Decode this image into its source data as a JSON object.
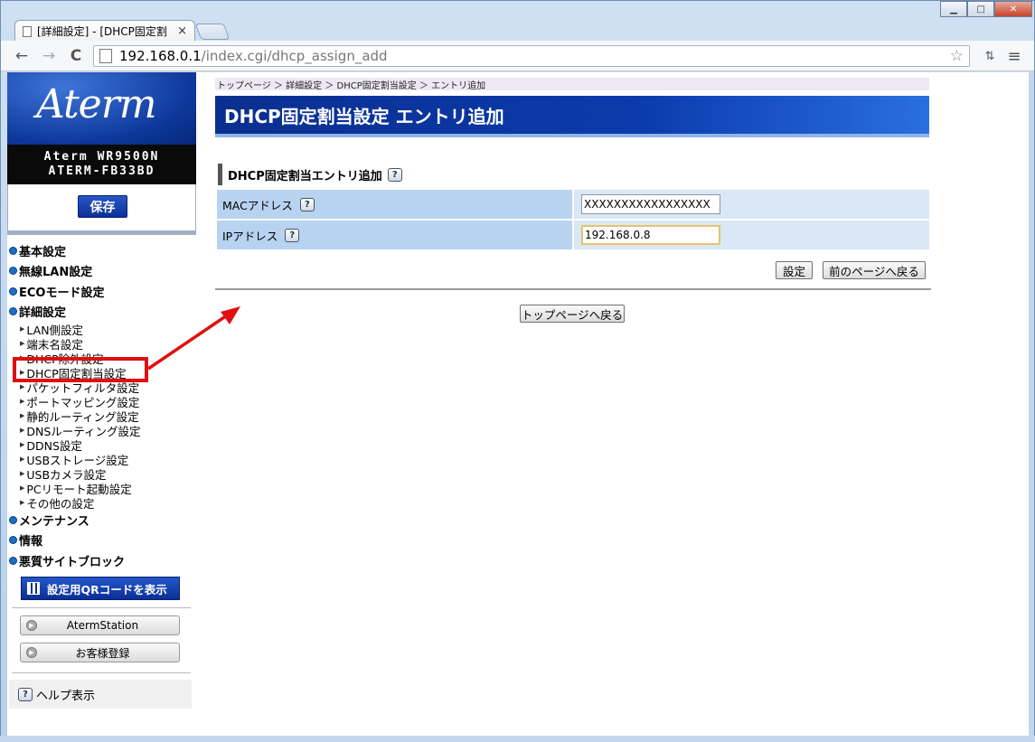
{
  "browser": {
    "tab_title": "[詳細設定] - [DHCP固定割",
    "tab_close": "×",
    "url_host": "192.168.0.1",
    "url_path": "/index.cgi/dhcp_assign_add",
    "back": "←",
    "forward": "→",
    "reload": "C",
    "star": "☆",
    "menu": "≡",
    "min": "▁",
    "max": "□",
    "close": "✕"
  },
  "sidebar": {
    "logo_text": "Aterm",
    "model_line1": "Aterm WR9500N",
    "model_line2": "ATERM-FB33BD",
    "save_label": "保存",
    "menu": [
      {
        "label": "基本設定",
        "type": "head"
      },
      {
        "label": "無線LAN設定",
        "type": "head"
      },
      {
        "label": "ECOモード設定",
        "type": "head"
      },
      {
        "label": "詳細設定",
        "type": "head"
      },
      {
        "label": "LAN側設定",
        "type": "sub"
      },
      {
        "label": "端末名設定",
        "type": "sub"
      },
      {
        "label": "DHCP除外設定",
        "type": "sub"
      },
      {
        "label": "DHCP固定割当設定",
        "type": "sub"
      },
      {
        "label": "パケットフィルタ設定",
        "type": "sub"
      },
      {
        "label": "ポートマッピング設定",
        "type": "sub"
      },
      {
        "label": "静的ルーティング設定",
        "type": "sub"
      },
      {
        "label": "DNSルーティング設定",
        "type": "sub"
      },
      {
        "label": "DDNS設定",
        "type": "sub"
      },
      {
        "label": "USBストレージ設定",
        "type": "sub"
      },
      {
        "label": "USBカメラ設定",
        "type": "sub"
      },
      {
        "label": "PCリモート起動設定",
        "type": "sub"
      },
      {
        "label": "その他の設定",
        "type": "sub"
      },
      {
        "label": "メンテナンス",
        "type": "head"
      },
      {
        "label": "情報",
        "type": "head"
      },
      {
        "label": "悪質サイトブロック",
        "type": "head"
      }
    ],
    "qr_label": "設定用QRコードを表示",
    "aterm_station": "AtermStation",
    "register": "お客様登録",
    "help": "ヘルプ表示"
  },
  "main": {
    "breadcrumb": "トップページ ＞ 詳細設定 ＞ DHCP固定割当設定 ＞ エントリ追加",
    "title": "DHCP固定割当設定 エントリ追加",
    "section": "DHCP固定割当エントリ追加",
    "help_mark": "?",
    "mac_label": "MACアドレス",
    "mac_value": "XXXXXXXXXXXXXXXXX",
    "ip_label": "IPアドレス",
    "ip_value": "192.168.0.8",
    "set_button": "設定",
    "back_button": "前のページへ戻る",
    "top_button": "トップページへ戻る"
  },
  "colors": {
    "highlight_annotation": "#e01010",
    "title_bar": "#0b3bad",
    "label_cell": "#b8d3f0"
  }
}
